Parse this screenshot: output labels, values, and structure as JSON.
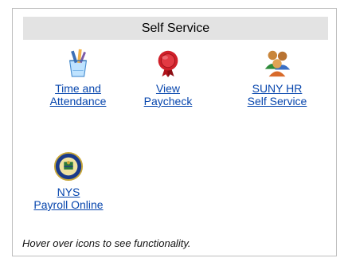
{
  "panel": {
    "title": "Self Service",
    "footer": "Hover over icons to see functionality."
  },
  "tiles": [
    {
      "icon": "pencil-cup-icon",
      "line1": "Time and",
      "line2": "Attendance"
    },
    {
      "icon": "wax-seal-icon",
      "line1": "View",
      "line2": "Paycheck"
    },
    {
      "icon": "users-group-icon",
      "line1": "SUNY HR",
      "line2": "Self Service"
    },
    {
      "icon": "nys-seal-icon",
      "line1": "NYS",
      "line2": "Payroll Online"
    }
  ],
  "colors": {
    "link": "#0645ad",
    "header_bg": "#e3e3e3",
    "border": "#bdbdbd"
  }
}
